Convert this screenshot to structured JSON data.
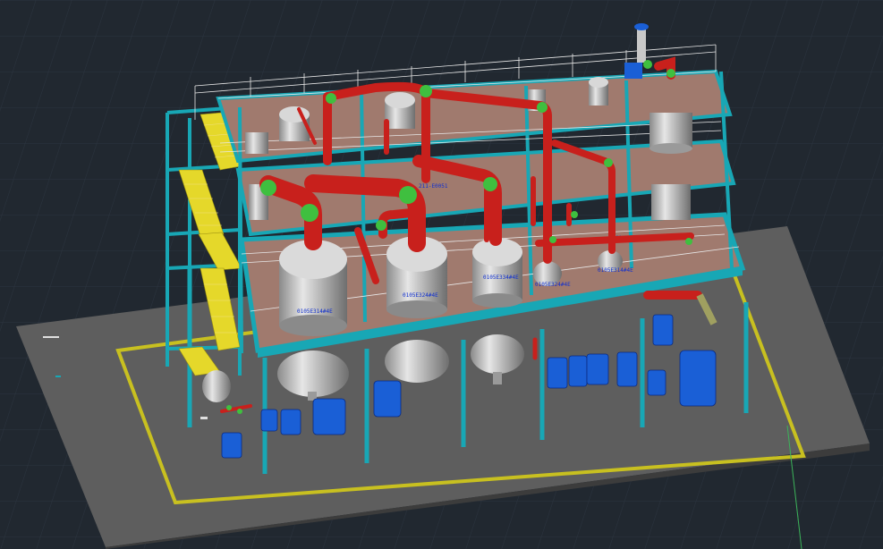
{
  "viewport": {
    "background": "#212830",
    "grid_color": "#2c3540",
    "axis_y_color": "#3cb45a"
  },
  "colors": {
    "slab": "#5e5e5e",
    "containment_line": "#c8c020",
    "steel": "#18a7b5",
    "floor": "#a07a6e",
    "railing": "#e8e8e8",
    "pipe": "#d52a24",
    "elbow": "#3fbf3f",
    "vessel": "#c8c8c8",
    "stair": "#e5d82a",
    "pump": "#1a5fd6",
    "tag_text": "#1030d0"
  },
  "tags": {
    "evap1": "0105E314#4E",
    "evap2": "0105E324#4E",
    "evap3": "0105E334#4E",
    "sep2": "0105E324#4E",
    "sep3": "0105E314#4E",
    "upper": "211-E0051",
    "pipe_tag": "0105E3#4E"
  },
  "icons": [
    "ucs-axis-icon"
  ]
}
